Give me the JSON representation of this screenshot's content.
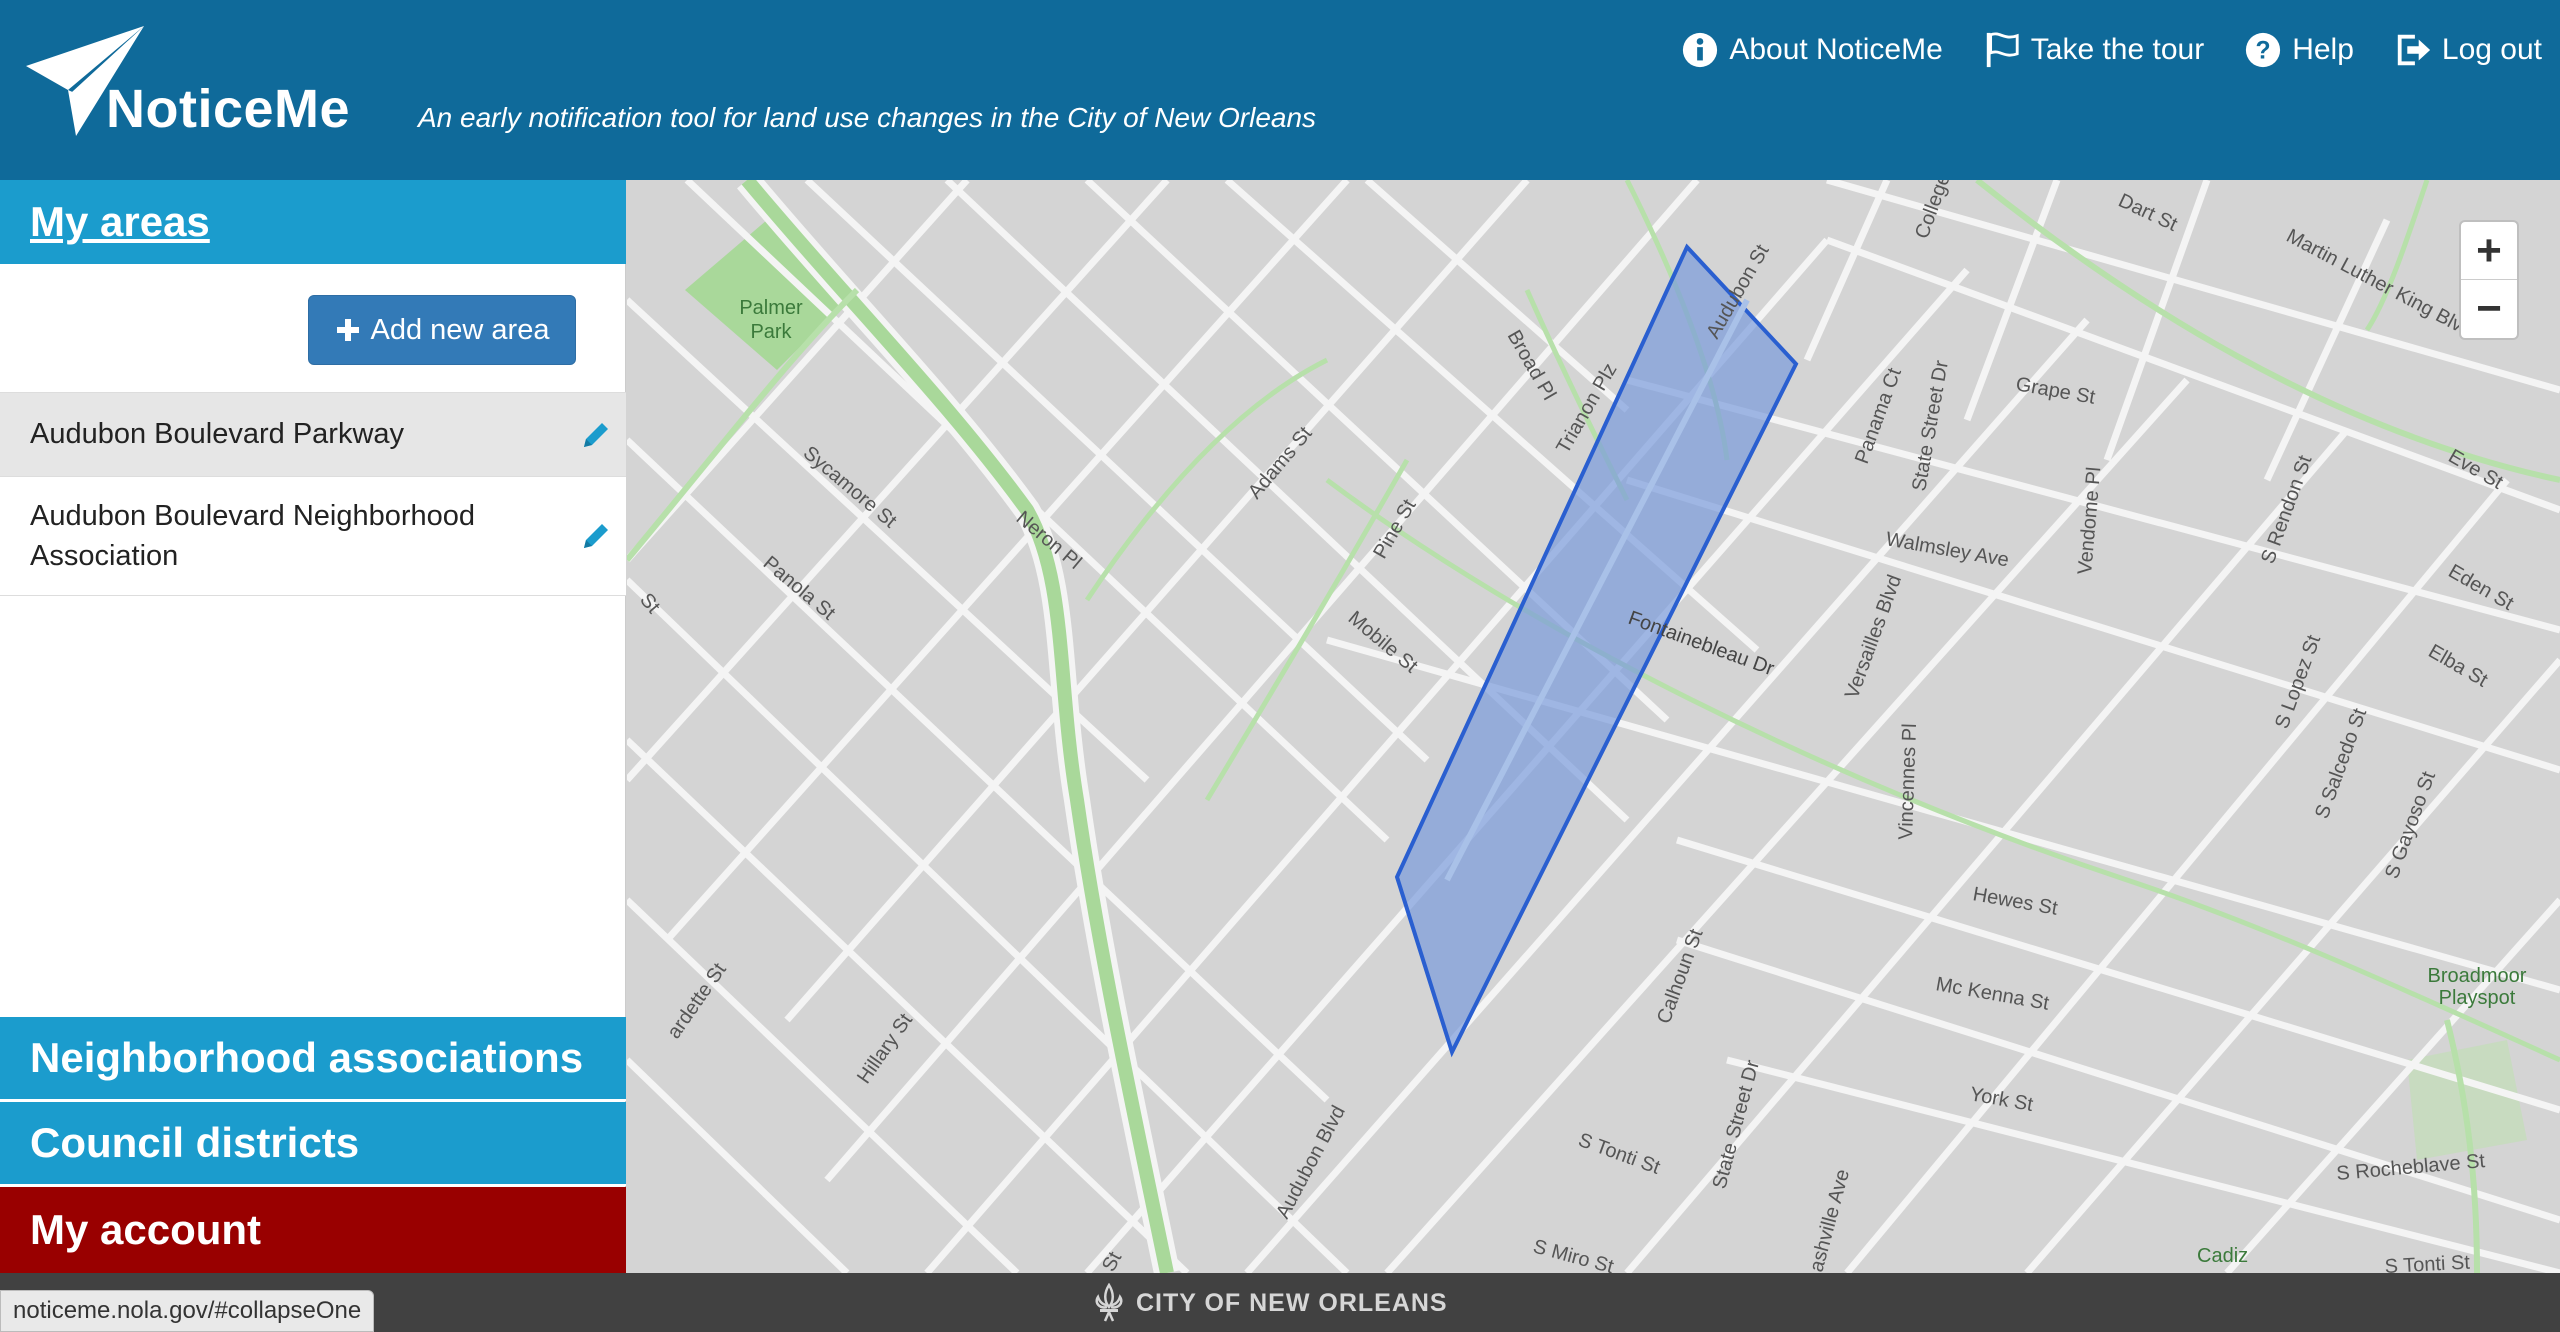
{
  "app": {
    "name": "NoticeMe",
    "tagline": "An early notification tool for land use changes in the City of New Orleans"
  },
  "topnav": {
    "about": "About NoticeMe",
    "tour": "Take the tour",
    "help": "Help",
    "logout": "Log out"
  },
  "sidebar": {
    "my_areas": "My areas",
    "add_area": "Add new area",
    "areas": [
      {
        "label": "Audubon Boulevard Parkway"
      },
      {
        "label": "Audubon Boulevard Neighborhood Association"
      }
    ],
    "neighborhood_associations": "Neighborhood associations",
    "council_districts": "Council districts",
    "my_account": "My account"
  },
  "map": {
    "zoom_in": "+",
    "zoom_out": "−",
    "labels": {
      "palmer_park": "Palmer",
      "palmer_park_2": "Park",
      "sycamore": "Sycamore St",
      "panola": "Panola St",
      "neron": "Neron Pl",
      "adams": "Adams St",
      "broad": "Broad Pl",
      "trianon": "Trianon Plz",
      "audubon_st": "Audubon St",
      "pine": "Pine St",
      "mobile": "Mobile St",
      "college": "College",
      "panama": "Panama Ct",
      "state_street": "State Street Dr",
      "dart": "Dart St",
      "mlk": "Martin Luther King Blvd",
      "grape": "Grape St",
      "walmsley": "Walmsley Ave",
      "vendome": "Vendome Pl",
      "fontainebleau": "Fontainebleau Dr",
      "rendon": "S Rendon St",
      "eve": "Eve St",
      "eden": "Eden St",
      "elba": "Elba St",
      "lopez": "S Lopez St",
      "salcedo": "S Salcedo St",
      "gayoso": "S Gayoso St",
      "vincennes": "Vincennes Pl",
      "hewes": "Hewes St",
      "mckenna": "Mc Kenna St",
      "york": "York St",
      "versailles": "Versailles Blvd",
      "calhoun": "Calhoun St",
      "state_street_2": "State Street Dr",
      "audubon_blvd": "Audubon Blvd",
      "hillary": "Hillary St",
      "cardette": "ardette St",
      "s_tonti": "S Tonti St",
      "s_miro": "S Miro St",
      "rocheblave": "S Rocheblave St",
      "nashville": "ashville Ave",
      "broadmoor": "Broadmoor",
      "broadmoor_2": "Playspot",
      "cadiz": "Cadiz",
      "s_tonti_2": "S Tonti St",
      "st_left": "St",
      "st_bottom": "St"
    }
  },
  "footer": {
    "brand": "CITY OF NEW ORLEANS",
    "status_url": "noticeme.nola.gov/#collapseOne"
  },
  "colors": {
    "header": "#0f6a9a",
    "accordion": "#1b9ccd",
    "account": "#990000",
    "button": "#337ab7",
    "polygon_fill": "#7b9bdc",
    "polygon_stroke": "#2a5fd0"
  }
}
